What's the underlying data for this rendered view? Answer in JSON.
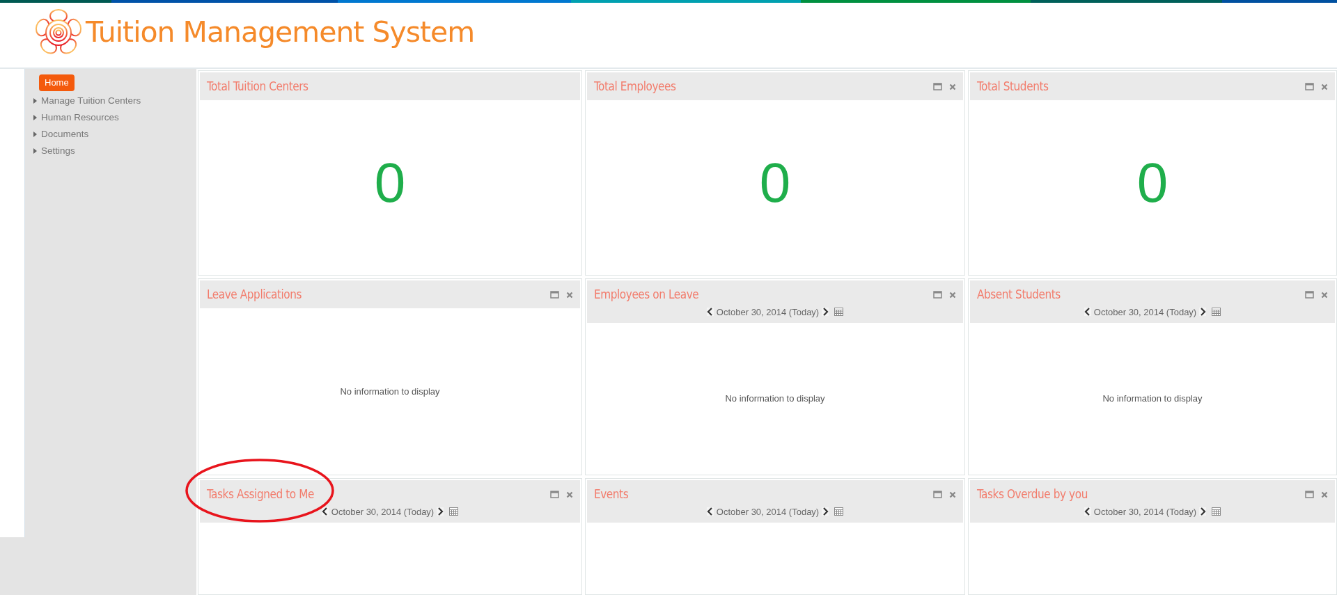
{
  "header": {
    "title": "Tuition Management System"
  },
  "sidebar": {
    "items": [
      {
        "label": "Home",
        "selected": true
      },
      {
        "label": "Manage Tuition Centers",
        "selected": false
      },
      {
        "label": "Human Resources",
        "selected": false
      },
      {
        "label": "Documents",
        "selected": false
      },
      {
        "label": "Settings",
        "selected": false
      }
    ]
  },
  "panels": [
    {
      "title": "Total Tuition Centers",
      "controls": false,
      "kind": "count",
      "value": "0"
    },
    {
      "title": "Total Employees",
      "controls": true,
      "kind": "count",
      "value": "0"
    },
    {
      "title": "Total Students",
      "controls": true,
      "kind": "count",
      "value": "0"
    },
    {
      "title": "Leave Applications",
      "controls": true,
      "kind": "message",
      "message": "No information to display"
    },
    {
      "title": "Employees on Leave",
      "controls": true,
      "date": "October 30, 2014 (Today)",
      "kind": "message",
      "message": "No information to display"
    },
    {
      "title": "Absent Students",
      "controls": true,
      "date": "October 30, 2014 (Today)",
      "kind": "message",
      "message": "No information to display"
    },
    {
      "title": "Tasks Assigned to Me",
      "controls": true,
      "date": "October 30, 2014 (Today)",
      "kind": "empty"
    },
    {
      "title": "Events",
      "controls": true,
      "date": "October 30, 2014 (Today)",
      "kind": "empty"
    },
    {
      "title": "Tasks Overdue by you",
      "controls": true,
      "date": "October 30, 2014 (Today)",
      "kind": "empty"
    }
  ]
}
